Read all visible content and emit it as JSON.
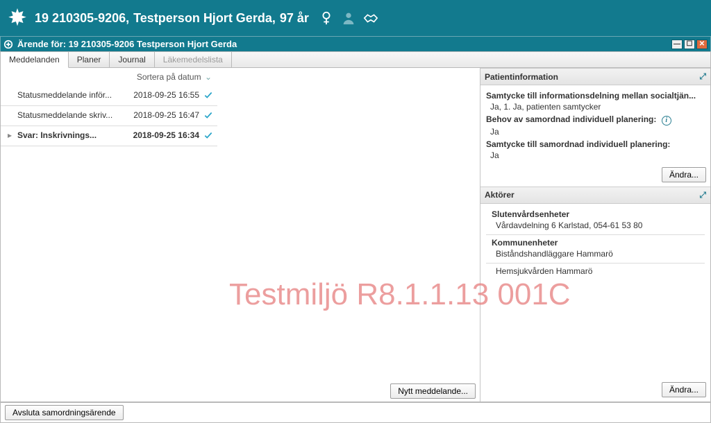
{
  "banner": {
    "ssn": "19 210305-9206,",
    "name": "Testperson Hjort Gerda,",
    "age": "97 år"
  },
  "window": {
    "title": "Ärende för: 19 210305-9206 Testperson Hjort Gerda"
  },
  "tabs": {
    "meddelanden": "Meddelanden",
    "planer": "Planer",
    "journal": "Journal",
    "lakemedel": "Läkemedelslista"
  },
  "sort_label": "Sortera på datum",
  "messages": [
    {
      "title": "Statusmeddelande inför...",
      "date": "2018-09-25 16:55",
      "bold": false,
      "caret": false
    },
    {
      "title": "Statusmeddelande skriv...",
      "date": "2018-09-25 16:47",
      "bold": false,
      "caret": false
    },
    {
      "title": "Svar: Inskrivnings...",
      "date": "2018-09-25 16:34",
      "bold": true,
      "caret": true
    }
  ],
  "patientinfo": {
    "header": "Patientinformation",
    "consent_label": "Samtycke till informationsdelning mellan socialtjän...",
    "consent_value": "Ja, 1. Ja, patienten samtycker",
    "need_label": "Behov av samordnad individuell planering:",
    "need_value": "Ja",
    "consent2_label": "Samtycke till samordnad individuell planering:",
    "consent2_value": "Ja",
    "edit_btn": "Ändra..."
  },
  "aktorer": {
    "header": "Aktörer",
    "sluten_label": "Slutenvårdsenheter",
    "sluten_value": "Vårdavdelning 6 Karlstad, 054-61 53 80",
    "kommun_label": "Kommunenheter",
    "kommun_value1": "Biståndshandläggare Hammarö",
    "kommun_value2": "Hemsjukvården Hammarö",
    "edit_btn": "Ändra..."
  },
  "buttons": {
    "nytt": "Nytt meddelande...",
    "avsluta": "Avsluta samordningsärende"
  },
  "watermark": "Testmiljö R8.1.1.13 001C"
}
